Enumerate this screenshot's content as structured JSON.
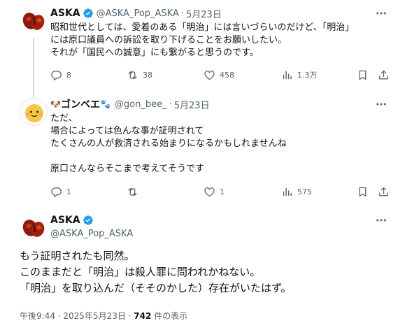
{
  "tweet1": {
    "name": "ASKA",
    "handle": "@ASKA_Pop_ASKA",
    "dot": "·",
    "date": "5月23日",
    "lines": [
      "昭和世代としては、愛着のある「明治」には言いづらいのだけど、「明治」",
      "には原口議員への訴訟を取り下げることをお願いしたい。",
      "それが「国民への誠意」にも繋がると思うのです。"
    ],
    "replies": "8",
    "reposts": "38",
    "likes": "458",
    "views": "1.3万"
  },
  "tweet2": {
    "name_prefix": "🐶",
    "name": "ゴンベエ",
    "name_suffix": "🐾",
    "handle": "@gon_bee_",
    "dot": "·",
    "date": "5月23日",
    "lines": [
      "ただ、",
      "場合によっては色んな事が証明されて",
      "たくさんの人が救済される始まりになるかもしれませんね",
      "",
      "原口さんならそこまで考えてそうです"
    ],
    "replies": "1",
    "reposts": "",
    "likes": "1",
    "views": "575"
  },
  "main": {
    "name": "ASKA",
    "handle": "@ASKA_Pop_ASKA",
    "lines": [
      "もう証明されたも同然。",
      "このままだと「明治」は殺人罪に問われかねない。",
      "「明治」を取り込んだ（そそのかした）存在がいたはず。"
    ],
    "time": "午後9:44 · 2025年5月23日 · ",
    "views_count": "742",
    "views_label": " 件の表示"
  },
  "colors": {
    "verified": "#1d9bf0",
    "icon": "#536471",
    "thread_line": "#cfd9de"
  },
  "icons": [
    "verified-badge-icon",
    "more-icon",
    "reply-icon",
    "repost-icon",
    "like-icon",
    "views-icon",
    "bookmark-icon",
    "share-icon"
  ]
}
